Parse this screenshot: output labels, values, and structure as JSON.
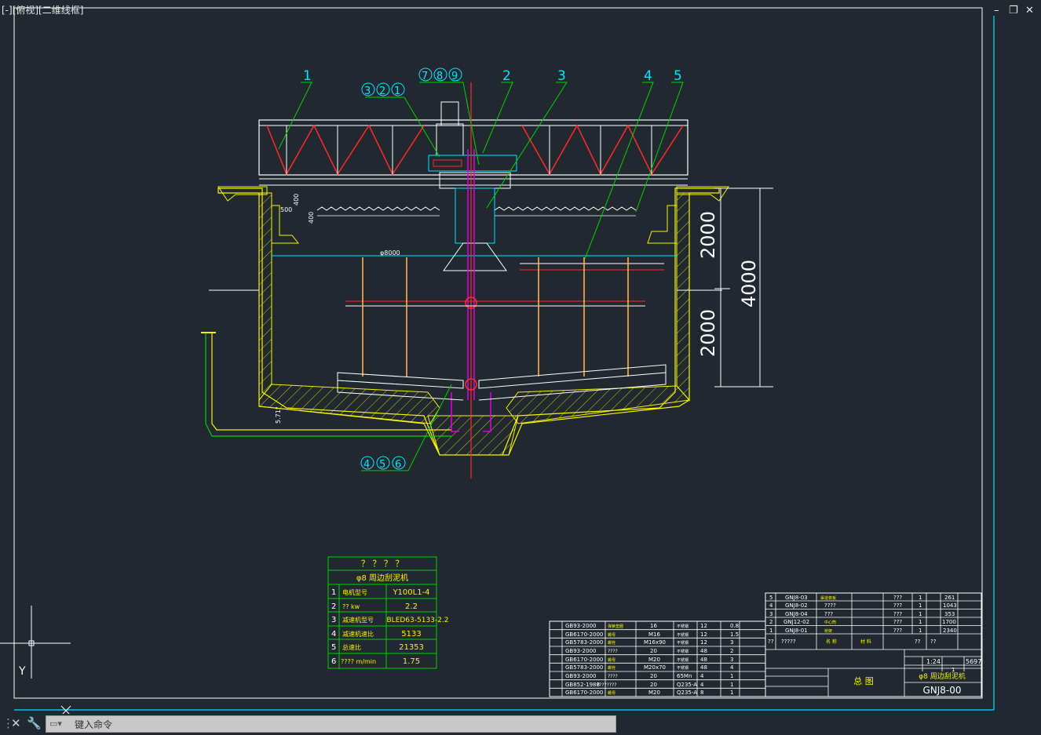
{
  "viewport": {
    "label": "[-][俯视][二维线框]",
    "minimize": "–",
    "restore": "❐",
    "close": "✕"
  },
  "drawing": {
    "balloons_top": [
      "1",
      "3",
      "2",
      "1",
      "7",
      "8",
      "9",
      "2",
      "3",
      "4",
      "5"
    ],
    "balloons_bottom": [
      "4",
      "5",
      "6"
    ],
    "dims": {
      "d2000a": "2000",
      "d2000b": "2000",
      "d4000": "4000",
      "d400a": "400",
      "d400b": "400",
      "d500": "500",
      "d8000": "φ8000",
      "slope": "5.71°"
    },
    "ucs_y": "Y"
  },
  "param_table": {
    "header": "？ ？ ？ ？",
    "subheader": "φ8 周边刮泥机",
    "rows": [
      {
        "no": "1",
        "name": "电机型号",
        "value": "Y100L1-4"
      },
      {
        "no": "2",
        "name": "?? kw",
        "value": "2.2"
      },
      {
        "no": "3",
        "name": "减速机型号",
        "value": "BLED63-5133-2.2"
      },
      {
        "no": "4",
        "name": "减速机速比",
        "value": "5133"
      },
      {
        "no": "5",
        "name": "总速比",
        "value": "21353"
      },
      {
        "no": "6",
        "name": "???? m/min",
        "value": "1.75"
      }
    ]
  },
  "parts_table": {
    "rows": [
      {
        "std": "GB93-2000",
        "name": "弹簧垫圈",
        "size": "16",
        "mat": "不锈钢",
        "qty": "12",
        "no": "0.8"
      },
      {
        "std": "GB6170-2000",
        "name": "螺母",
        "size": "M16",
        "mat": "不锈钢",
        "qty": "12",
        "no": "1.5"
      },
      {
        "std": "GB5783-2000",
        "name": "螺栓",
        "size": "M16x90",
        "mat": "不锈钢",
        "qty": "12",
        "no": "3"
      },
      {
        "std": "GB93-2000",
        "name": "????",
        "size": "20",
        "mat": "不锈钢",
        "qty": "48",
        "no": "2"
      },
      {
        "std": "GB6170-2000",
        "name": "螺母",
        "size": "M20",
        "mat": "不锈钢",
        "qty": "48",
        "no": "3"
      },
      {
        "std": "GB5783-2000",
        "name": "螺栓",
        "size": "M20x70",
        "mat": "不锈钢",
        "qty": "48",
        "no": "4"
      },
      {
        "std": "GB93-2000",
        "name": "????",
        "size": "20",
        "mat": "65Mn",
        "qty": "4",
        "no": "1"
      },
      {
        "std": "GB852-1988",
        "name": "????????",
        "size": "20",
        "mat": "Q235-A",
        "qty": "4",
        "no": "1"
      },
      {
        "std": "GB6170-2000",
        "name": "螺母",
        "size": "M20",
        "mat": "Q235-A",
        "qty": "8",
        "no": "1"
      }
    ]
  },
  "bom_table": {
    "rows": [
      {
        "seq": "5",
        "code": "GNJ8-03",
        "name": "渠道衰板",
        "mat": "???",
        "qty": "1",
        "wt": "261"
      },
      {
        "seq": "4",
        "code": "GNJ8-02",
        "name": "????",
        "mat": "???",
        "qty": "1",
        "wt": "1043"
      },
      {
        "seq": "3",
        "code": "GNJ8-04",
        "name": "???",
        "mat": "???",
        "qty": "1",
        "wt": "353"
      },
      {
        "seq": "2",
        "code": "GNJ12-02",
        "name": "中心筒",
        "mat": "???",
        "qty": "1",
        "wt": "1700"
      },
      {
        "seq": "1",
        "code": "GNJ8-01",
        "name": "桥架",
        "mat": "???",
        "qty": "1",
        "wt": "2340"
      }
    ],
    "header": {
      "seq": "??",
      "code": "?????",
      "name": "名 称",
      "mat": "材 料",
      "qty": "??",
      "wt": "??"
    }
  },
  "title_block": {
    "title": "总 图",
    "product": "φ8 周边刮泥机",
    "drawing_no": "GNJ8-00",
    "scale": "1:24",
    "weight": "5697",
    "sheet": "1"
  },
  "command_line": {
    "placeholder": "键入命令"
  },
  "colors": {
    "background": "#212830",
    "white": "#ffffff",
    "red": "#ff2a2a",
    "yellow": "#f5f500",
    "green": "#00d400",
    "cyan": "#00e5ff",
    "magenta": "#e000e0",
    "orange": "#ffb050"
  }
}
